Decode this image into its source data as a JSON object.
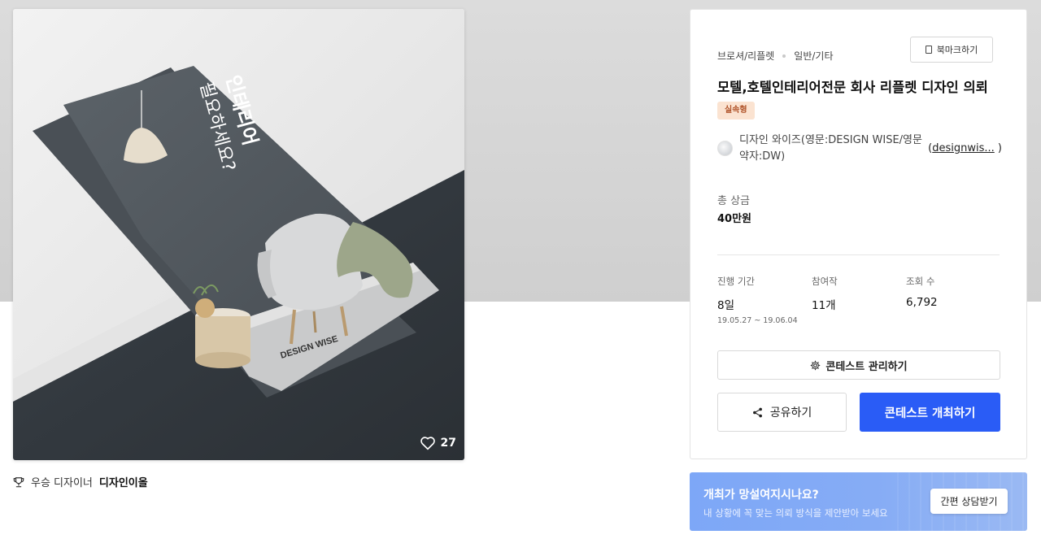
{
  "hero": {
    "poster_line1": "인테리어",
    "poster_line2": "필요하세요?",
    "brand": "DESIGN WISE",
    "like_count": "27"
  },
  "winner": {
    "label": "우승 디자이너",
    "name": "디자인이올"
  },
  "panel": {
    "category": "브로셔/리플렛",
    "subcategory": "일반/기타",
    "bookmark_label": "북마크하기",
    "title": "모텔,호텔인테리어전문 회사 리플렛 디자인 의뢰",
    "badge": "실속형",
    "designer_name": "디자인 와이즈(영문:DESIGN WISE/영문약자:DW)",
    "designer_id": "designwis...",
    "prize_label": "총 상금",
    "prize_value": "40만원",
    "stats": [
      {
        "label": "진행 기간",
        "value": "8일",
        "sub": "19.05.27 ~ 19.06.04"
      },
      {
        "label": "참여작",
        "value": "11개"
      },
      {
        "label": "조회 수",
        "value": "6,792"
      }
    ],
    "manage_label": "콘테스트 관리하기",
    "share_label": "공유하기",
    "open_label": "콘테스트 개최하기"
  },
  "consult": {
    "question": "개최가 망설여지시나요?",
    "subtext": "내 상황에 꼭 맞는 의뢰 방식을 제안받아 보세요",
    "button": "간편 상담받기"
  },
  "colors": {
    "accent": "#2a5cf6",
    "badge_bg": "#fbe3d1",
    "badge_text": "#b0542a",
    "consult_bg": "#86acf5"
  }
}
